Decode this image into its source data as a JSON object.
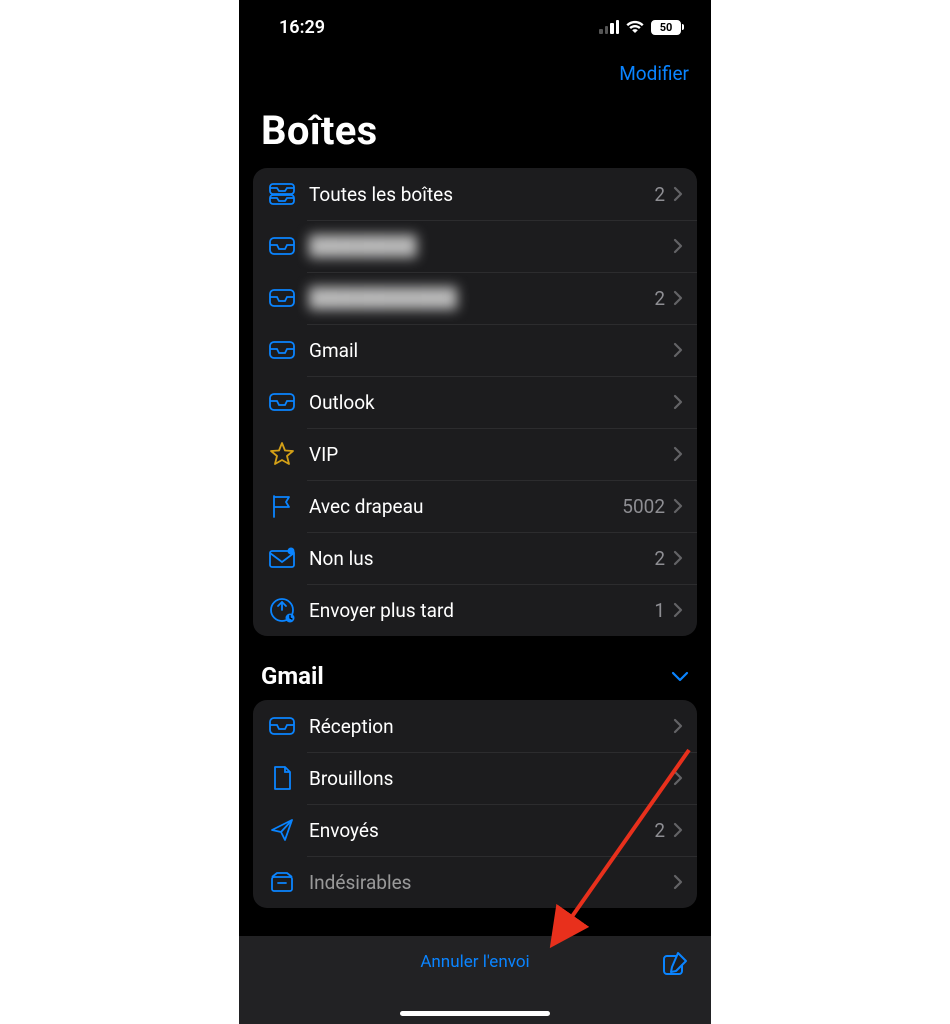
{
  "status": {
    "time": "16:29",
    "battery": "50"
  },
  "nav": {
    "edit": "Modifier"
  },
  "title": "Boîtes",
  "mailboxes": [
    {
      "icon": "all-inboxes",
      "label": "Toutes les boîtes",
      "count": "2",
      "blurred": false
    },
    {
      "icon": "inbox",
      "label": "████████",
      "count": "",
      "blurred": true
    },
    {
      "icon": "inbox",
      "label": "███████████",
      "count": "2",
      "blurred": true
    },
    {
      "icon": "inbox",
      "label": "Gmail",
      "count": "",
      "blurred": false
    },
    {
      "icon": "inbox",
      "label": "Outlook",
      "count": "",
      "blurred": false
    },
    {
      "icon": "star",
      "label": "VIP",
      "count": "",
      "blurred": false
    },
    {
      "icon": "flag",
      "label": "Avec drapeau",
      "count": "5002",
      "blurred": false
    },
    {
      "icon": "unread",
      "label": "Non lus",
      "count": "2",
      "blurred": false
    },
    {
      "icon": "send-later",
      "label": "Envoyer plus tard",
      "count": "1",
      "blurred": false
    }
  ],
  "section": {
    "title": "Gmail"
  },
  "gmail_folders": [
    {
      "icon": "inbox",
      "label": "Réception",
      "count": ""
    },
    {
      "icon": "drafts",
      "label": "Brouillons",
      "count": ""
    },
    {
      "icon": "sent",
      "label": "Envoyés",
      "count": "2"
    },
    {
      "icon": "junk",
      "label": "Indésirables",
      "count": ""
    }
  ],
  "toolbar": {
    "undo_send": "Annuler l'envoi"
  },
  "colors": {
    "accent": "#0a84ff",
    "star": "#d4a017"
  }
}
